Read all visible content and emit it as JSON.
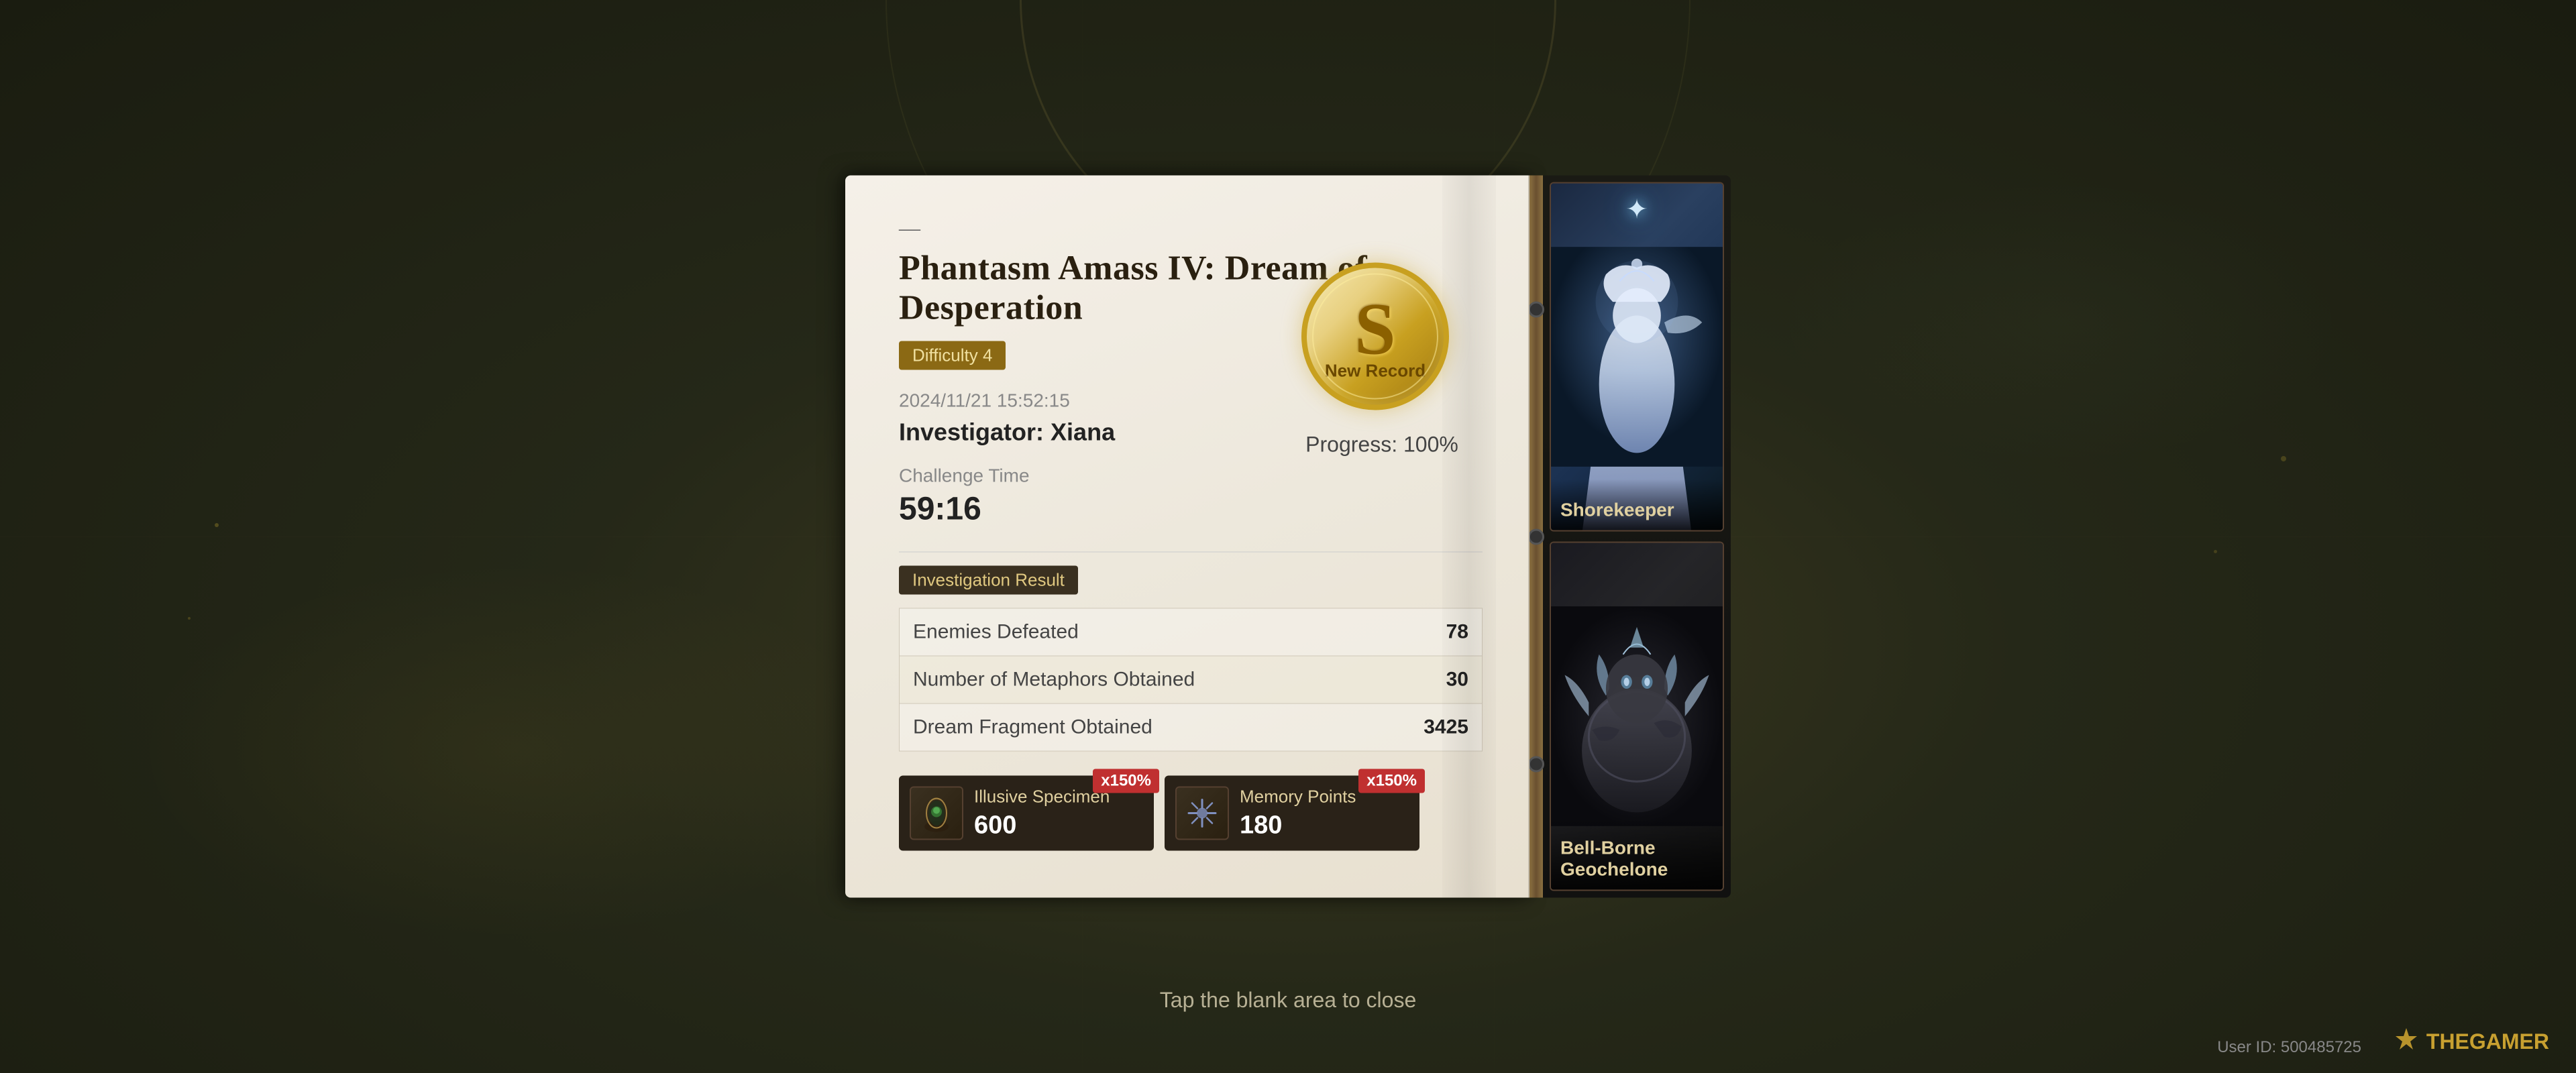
{
  "background": {
    "color": "#2a2e1a"
  },
  "panel": {
    "dash": "—",
    "title": "Phantasm Amass IV: Dream of Desperation",
    "difficulty_badge": "Difficulty 4",
    "timestamp": "2024/11/21 15:52:15",
    "investigator_label": "Investigator: Xiana",
    "challenge_time_label": "Challenge Time",
    "challenge_time_value": "59:16",
    "rank_letter": "S",
    "rank_sublabel": "New Record",
    "progress_text": "Progress: 100%",
    "investigation_badge": "Investigation Result",
    "results": [
      {
        "label": "Enemies Defeated",
        "value": "78"
      },
      {
        "label": "Number of Metaphors Obtained",
        "value": "30"
      },
      {
        "label": "Dream Fragment Obtained",
        "value": "3425"
      }
    ],
    "rewards": [
      {
        "name": "Illusive Specimen",
        "amount": "600",
        "multiplier": "x150%",
        "icon": "🧪"
      },
      {
        "name": "Memory Points",
        "amount": "180",
        "multiplier": "x150%",
        "icon": "✦"
      }
    ]
  },
  "sidebar": {
    "characters": [
      {
        "name": "Shorekeeper",
        "type": "shorekeeper"
      },
      {
        "name": "Bell-Borne\nGeochelone",
        "type": "bellborne"
      }
    ]
  },
  "footer": {
    "tap_to_close": "Tap the blank area to close",
    "user_id": "User ID: 500485725",
    "brand": "THEGAMER"
  }
}
